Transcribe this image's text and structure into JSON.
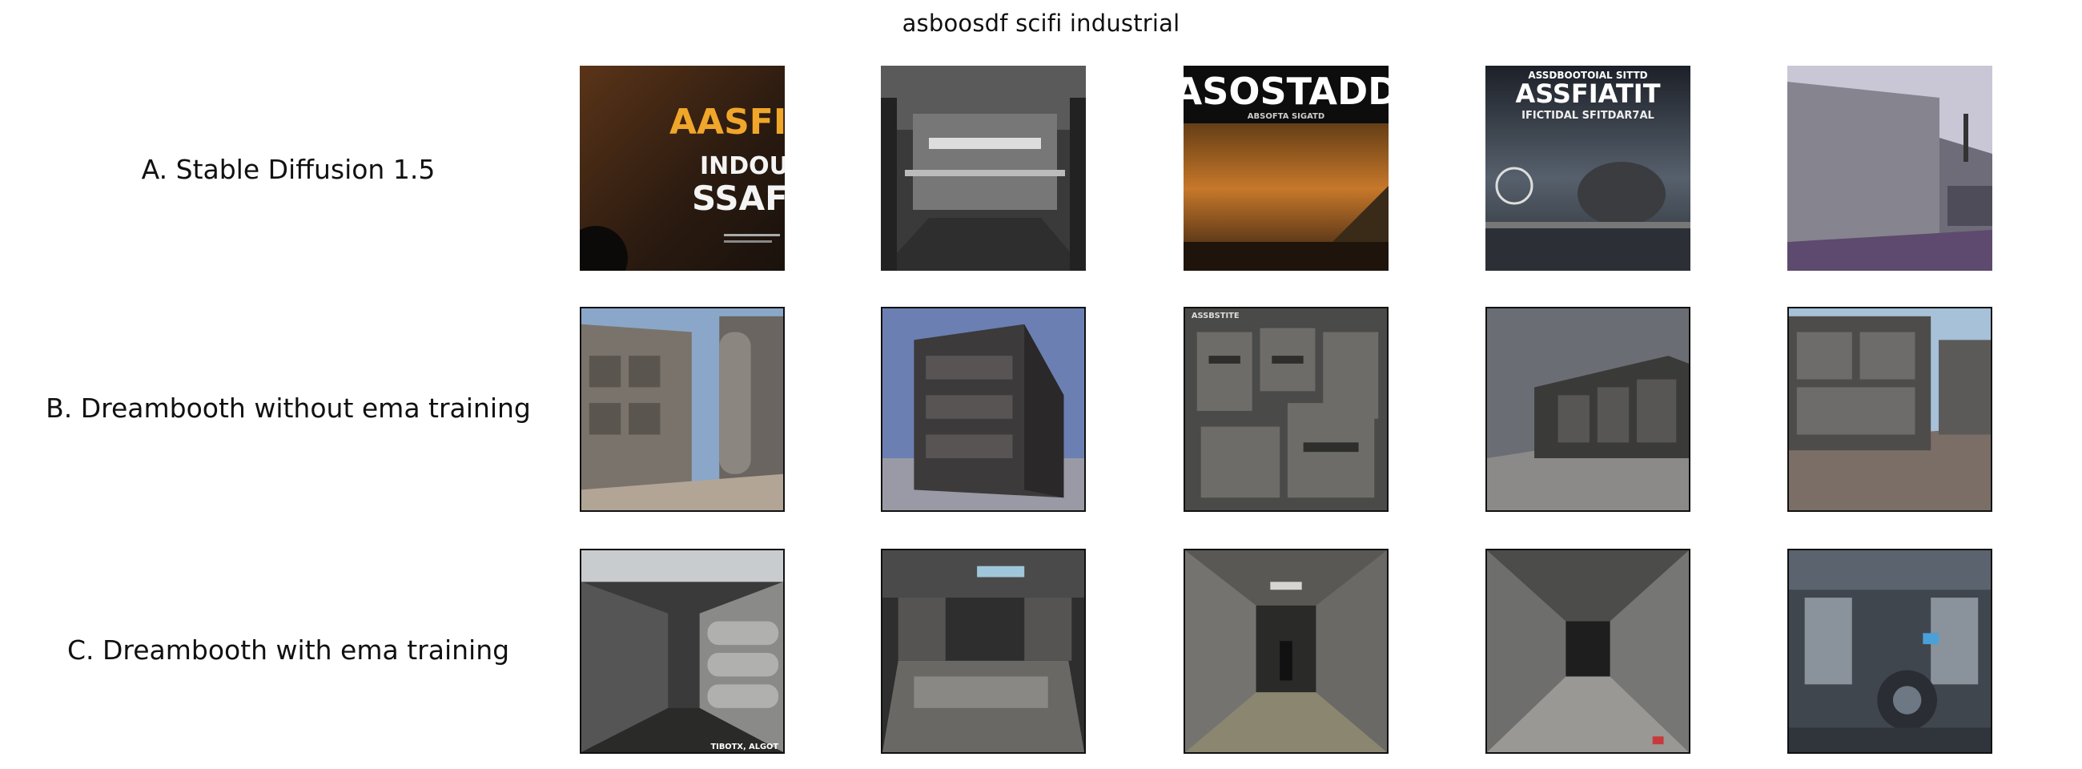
{
  "title": "asboosdf scifi industrial",
  "rows": [
    {
      "label": "A. Stable Diffusion 1.5"
    },
    {
      "label": "B. Dreambooth without ema training"
    },
    {
      "label": "C. Dreambooth with ema training"
    }
  ],
  "poster_text": {
    "a1_line1": "AASFIIT",
    "a1_line2": "INDOUT",
    "a1_line3": "SSAFTI",
    "a3_title": "ASOSTADD",
    "a3_sub": "ABSOFTA SIGATD",
    "a4_top": "ASSDBOOTOIAL SITTD",
    "a4_title": "ASSFIATIT",
    "a4_sub": "IFICTIDAL SFITDAR7AL",
    "b3_corner": "ASSBSTITE",
    "c1_corner": "TIBOTX, ALGOT"
  },
  "colors": {
    "poster_orange": "#f0a62a",
    "metal_dark": "#3a3a3a",
    "metal_mid": "#7c7c7c",
    "sky_blue": "#6b7fb3",
    "purple_ground": "#5d4a6e"
  }
}
